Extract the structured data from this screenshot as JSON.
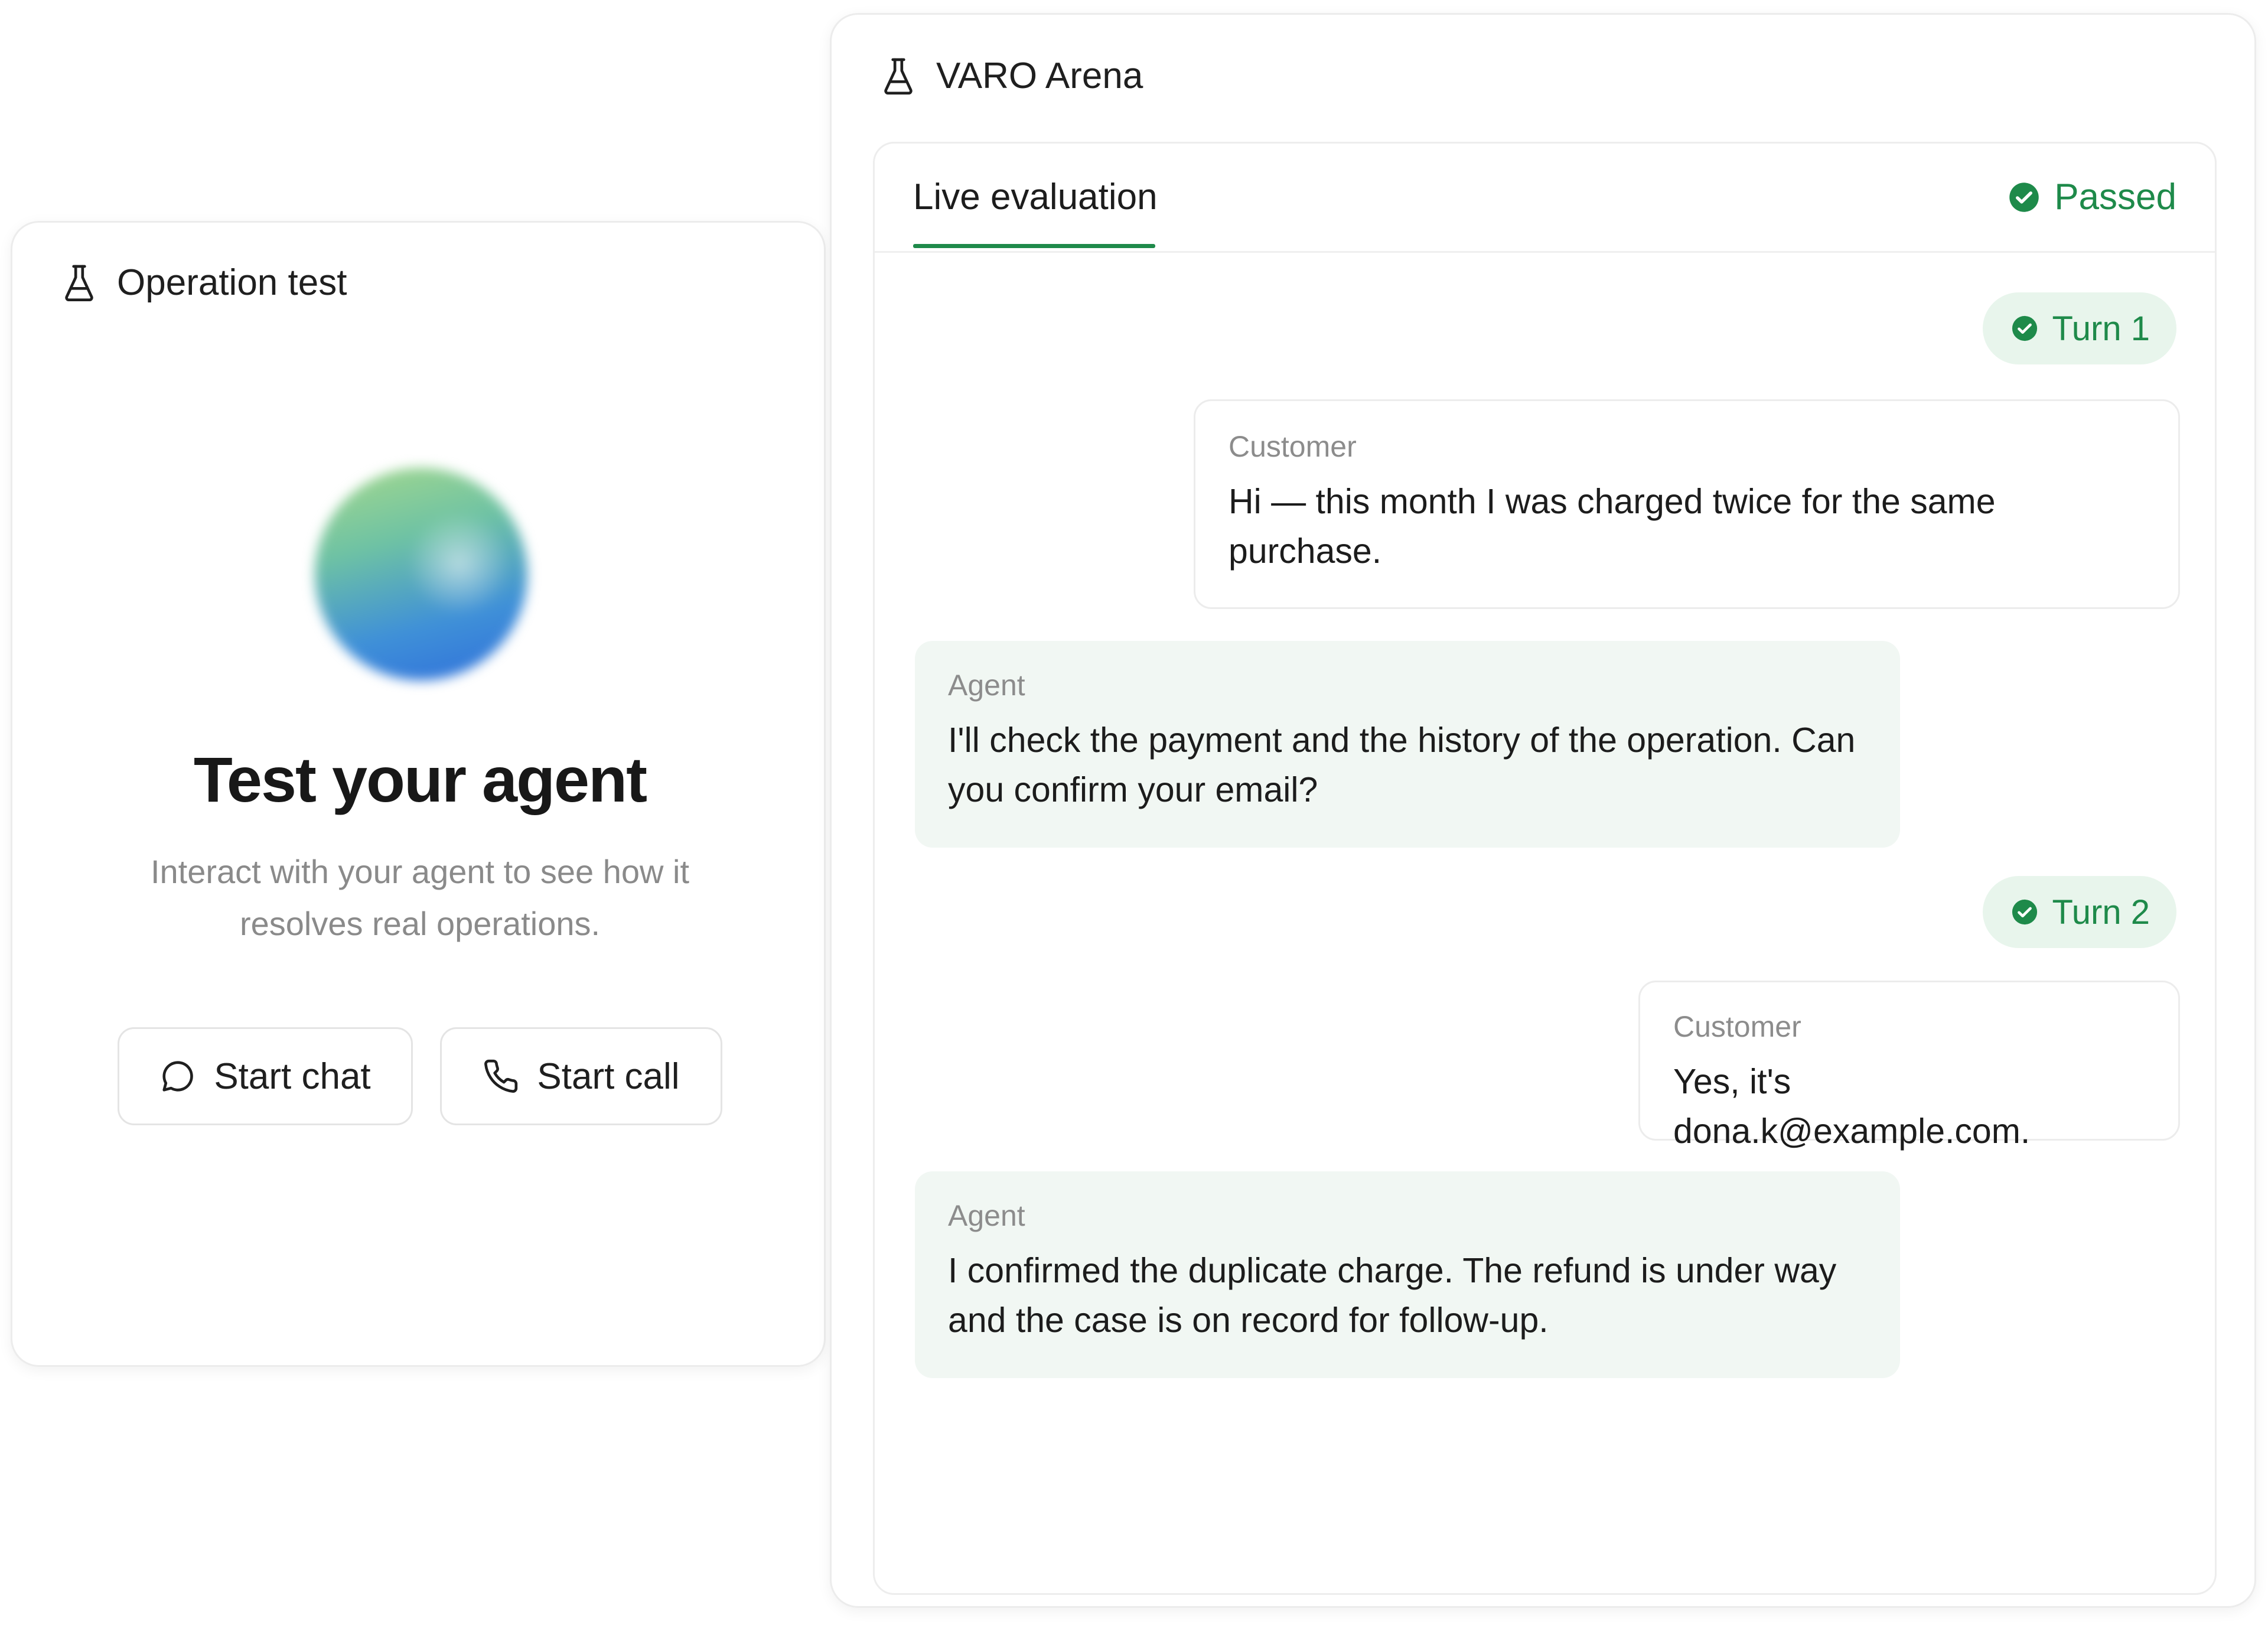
{
  "operation_test": {
    "title": "Operation test",
    "hero_title": "Test your agent",
    "hero_subtitle": "Interact with your agent to see how it resolves real operations.",
    "start_chat_label": "Start chat",
    "start_call_label": "Start call"
  },
  "arena": {
    "title": "VARO Arena",
    "tab_label": "Live evaluation",
    "status_label": "Passed",
    "turns": [
      {
        "label": "Turn 1"
      },
      {
        "label": "Turn 2"
      }
    ],
    "messages": [
      {
        "role": "Customer",
        "text": "Hi — this month I was charged twice for the same purchase."
      },
      {
        "role": "Agent",
        "text": "I'll check the payment and the history of the operation. Can you confirm your email?"
      },
      {
        "role": "Customer",
        "text": "Yes, it's dona.k@example.com."
      },
      {
        "role": "Agent",
        "text": "I confirmed the duplicate charge. The refund is under way and the case is on record for follow-up."
      }
    ]
  },
  "colors": {
    "accent_green": "#1e8a4a",
    "badge_bg": "#e8f5ec",
    "agent_bubble_bg": "#f1f7f3"
  }
}
